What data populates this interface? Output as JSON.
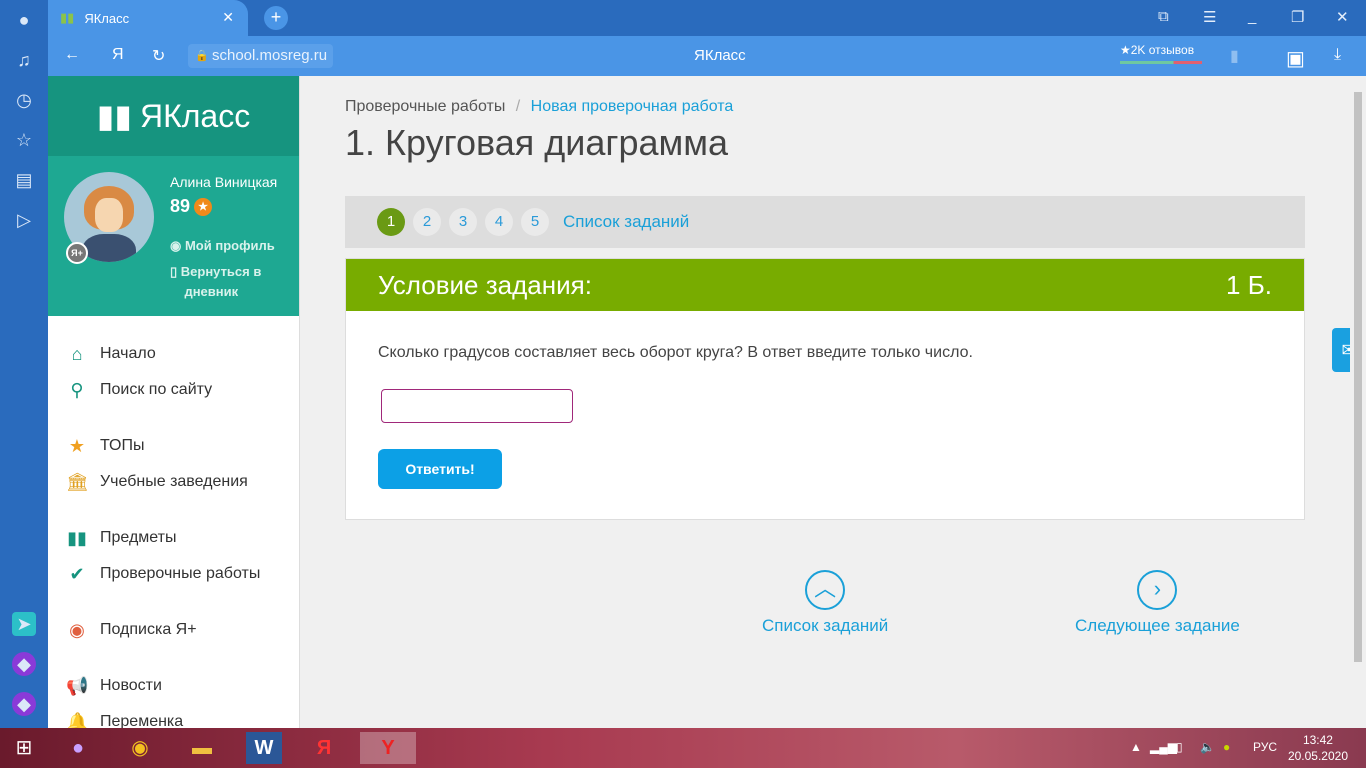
{
  "browser": {
    "tab_title": "ЯКласс",
    "url": "school.mosreg.ru",
    "page_title": "ЯКласс",
    "reviews": "★2K отзывов",
    "yandex": "Я"
  },
  "profile": {
    "logo": "ЯКласс",
    "name": "Алина Виницкая",
    "score": "89",
    "my_profile": "Мой профиль",
    "return_1": "Вернуться в",
    "return_2": "дневник",
    "badge": "Я+"
  },
  "menu": [
    "Начало",
    "Поиск по сайту",
    "ТОПы",
    "Учебные заведения",
    "Предметы",
    "Проверочные работы",
    "Подписка Я+",
    "Новости",
    "Переменка"
  ],
  "breadcrumb": {
    "parent": "Проверочные работы",
    "sep": "/",
    "current": "Новая проверочная работа"
  },
  "title": "1. Круговая диаграмма",
  "steps": [
    "1",
    "2",
    "3",
    "4",
    "5"
  ],
  "active_step": "1",
  "task_list": "Список заданий",
  "card": {
    "header": "Условие задания:",
    "points": "1 Б.",
    "question": "Сколько градусов составляет весь оборот круга? В ответ введите только число.",
    "answer": "",
    "submit": "Ответить!"
  },
  "bottom": {
    "list": "Список заданий",
    "next": "Следующее задание"
  },
  "taskbar": {
    "lang": "РУС",
    "time": "13:42",
    "date": "20.05.2020"
  }
}
